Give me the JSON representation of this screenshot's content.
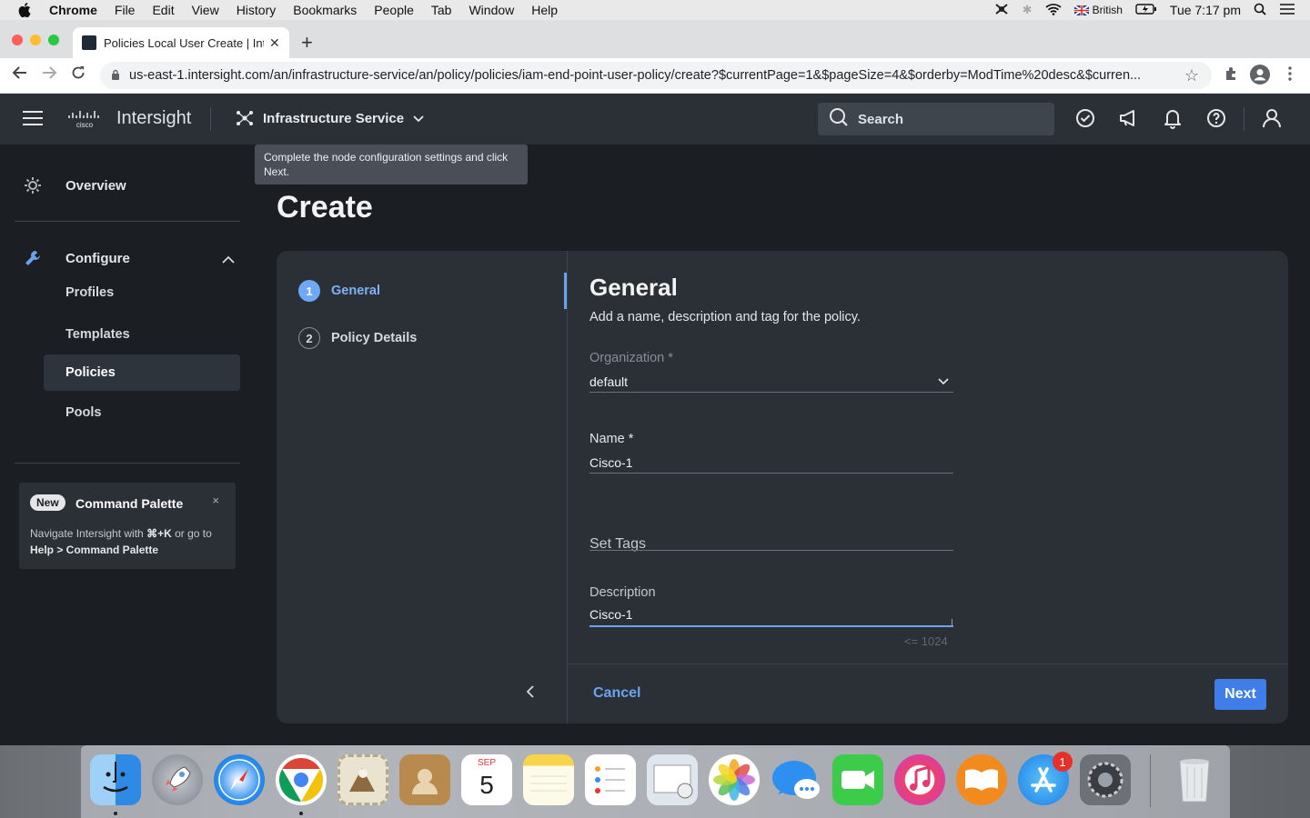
{
  "menubar": {
    "app": "Chrome",
    "items": [
      "File",
      "Edit",
      "View",
      "History",
      "Bookmarks",
      "People",
      "Tab",
      "Window",
      "Help"
    ],
    "input_source": "British",
    "clock": "Tue 7:17 pm"
  },
  "browser": {
    "tab_title": "Policies Local User Create | Intersight",
    "url": "us-east-1.intersight.com/an/infrastructure-service/an/policy/policies/iam-end-point-user-policy/create?$currentPage=1&$pageSize=4&$orderby=ModTime%20desc&$curren..."
  },
  "header": {
    "logo_text": "cisco",
    "app_name": "Intersight",
    "service": "Infrastructure Service",
    "search_placeholder": "Search"
  },
  "sidebar": {
    "overview": "Overview",
    "configure": "Configure",
    "items": [
      {
        "label": "Profiles",
        "active": false
      },
      {
        "label": "Templates",
        "active": false
      },
      {
        "label": "Policies",
        "active": true
      },
      {
        "label": "Pools",
        "active": false
      }
    ],
    "command_palette": {
      "badge": "New",
      "title": "Command Palette",
      "close": "×",
      "text_prefix": "Navigate Intersight with ",
      "shortcut": "⌘+K",
      "text_mid": " or go to ",
      "path": "Help > Command Palette"
    }
  },
  "page": {
    "tooltip": "Complete the node configuration settings and click Next.",
    "title": "Create"
  },
  "wizard": {
    "steps": [
      {
        "num": "1",
        "label": "General",
        "active": true
      },
      {
        "num": "2",
        "label": "Policy Details",
        "active": false
      }
    ],
    "form_title": "General",
    "form_subtitle": "Add a name, description and tag for the policy.",
    "organization": {
      "label": "Organization *",
      "value": "default"
    },
    "name": {
      "label": "Name *",
      "value": "Cisco-1"
    },
    "tags": {
      "label": "Set Tags"
    },
    "description": {
      "label": "Description",
      "value": "Cisco-1",
      "limit": "<= 1024"
    },
    "cancel": "Cancel",
    "next": "Next"
  },
  "dock": {
    "calendar_month": "SEP",
    "calendar_day": "5",
    "app_store_badge": "1"
  },
  "colors": {
    "accent": "#3f7ee8",
    "header_bg": "#2b3036",
    "main_bg": "#1b1f24"
  }
}
